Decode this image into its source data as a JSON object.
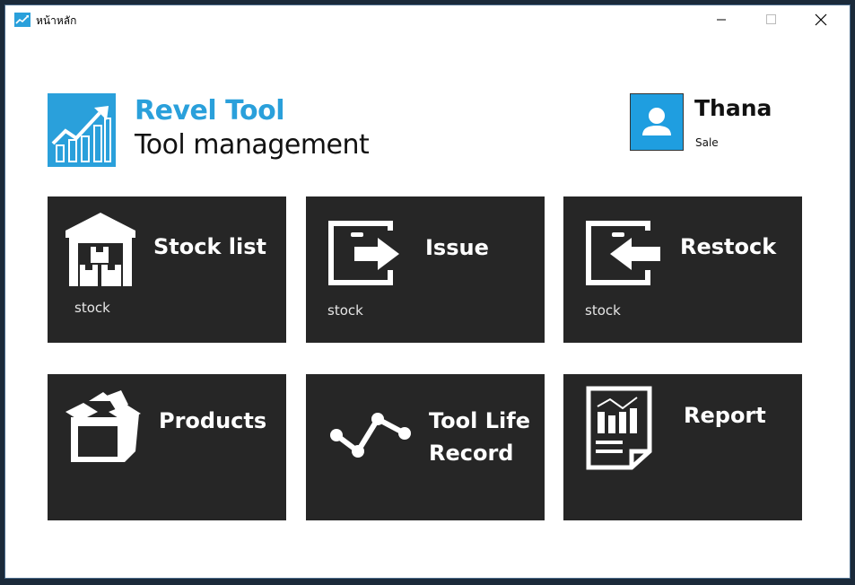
{
  "window": {
    "title": "หน้าหลัก"
  },
  "brand": {
    "name": "Revel Tool",
    "subtitle": "Tool management",
    "accent": "#2aa0db"
  },
  "user": {
    "name": "Thana",
    "role": "Sale",
    "avatar_color": "#1f9ee0"
  },
  "tiles": {
    "stock_list": {
      "label": "Stock list",
      "sub": "stock",
      "icon": "warehouse-icon"
    },
    "issue": {
      "label": "Issue",
      "sub": "stock",
      "icon": "export-icon"
    },
    "restock": {
      "label": "Restock",
      "sub": "stock",
      "icon": "import-icon"
    },
    "products": {
      "label": "Products",
      "icon": "open-box-icon"
    },
    "tool_life": {
      "label_line1": "Tool Life",
      "label_line2": "Record",
      "icon": "line-graph-icon"
    },
    "report": {
      "label": "Report",
      "icon": "report-document-icon"
    }
  },
  "colors": {
    "tile_bg": "#262626",
    "tile_text": "#ffffff"
  }
}
